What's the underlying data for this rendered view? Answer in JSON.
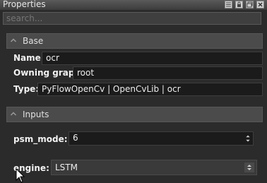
{
  "window": {
    "title": "Properties"
  },
  "search": {
    "placeholder": "search..."
  },
  "base": {
    "section_label": "Base",
    "name_label": "Name:",
    "name_value": "ocr",
    "owning_graph_label": "Owning graph:",
    "owning_graph_value": "root",
    "type_label": "Type:",
    "type_value": "PyFlowOpenCv | OpenCvLib | ocr"
  },
  "inputs": {
    "section_label": "Inputs",
    "psm_mode_label": "psm_mode:",
    "psm_mode_value": "6",
    "engine_label": "engine:",
    "engine_value": "LSTM"
  }
}
